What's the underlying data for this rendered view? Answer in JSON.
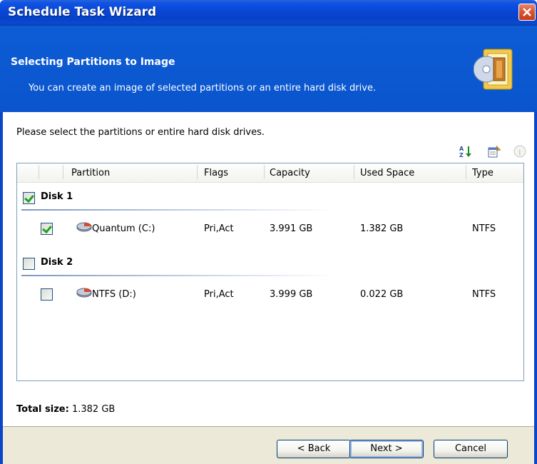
{
  "window": {
    "title": "Schedule Task Wizard"
  },
  "header": {
    "title": "Selecting Partitions to Image",
    "subtitle": "You can create an image of selected partitions or an entire hard disk drive."
  },
  "instruction": "Please select the partitions or entire hard disk drives.",
  "toolbar": {
    "icons": [
      "sort-icon",
      "properties-icon",
      "info-icon"
    ]
  },
  "table": {
    "columns": [
      "Partition",
      "Flags",
      "Capacity",
      "Used Space",
      "Type"
    ],
    "groups": [
      {
        "label": "Disk 1",
        "checked": true,
        "rows": [
          {
            "partition": "Quantum (C:)",
            "flags": "Pri,Act",
            "capacity": "3.991 GB",
            "used": "1.382 GB",
            "type": "NTFS",
            "checked": true
          }
        ]
      },
      {
        "label": "Disk 2",
        "checked": false,
        "rows": [
          {
            "partition": "NTFS (D:)",
            "flags": "Pri,Act",
            "capacity": "3.999 GB",
            "used": "0.022 GB",
            "type": "NTFS",
            "checked": false
          }
        ]
      }
    ]
  },
  "total": {
    "label": "Total size:",
    "value": "1.382 GB"
  },
  "buttons": {
    "back": "< Back",
    "next": "Next >",
    "cancel": "Cancel"
  },
  "colors": {
    "header_bg": "#0a5ad3",
    "title_bar": "#0846d4",
    "check_green": "#21a121",
    "footer_bg": "#ece9d8"
  }
}
